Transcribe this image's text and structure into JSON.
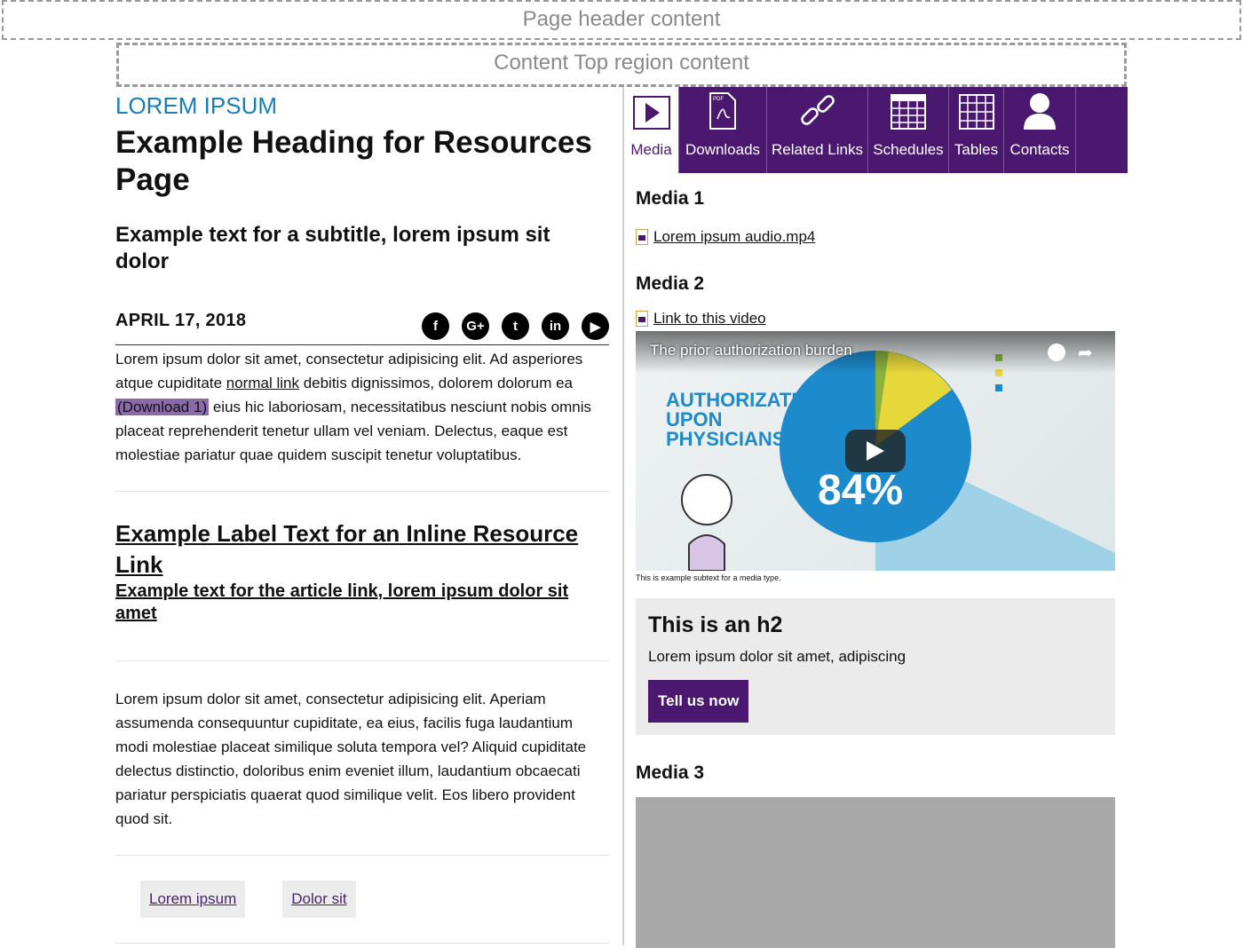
{
  "regions": {
    "header": "Page header content",
    "content_top": "Content Top region content"
  },
  "main": {
    "eyebrow": "LOREM IPSUM",
    "title": "Example Heading for Resources Page",
    "subtitle": "Example text for a subtitle, lorem ipsum sit dolor",
    "date": "APRIL 17, 2018",
    "social": [
      {
        "icon": "facebook-icon",
        "glyph": "f"
      },
      {
        "icon": "google-plus-icon",
        "glyph": "G+"
      },
      {
        "icon": "twitter-icon",
        "glyph": "t"
      },
      {
        "icon": "linkedin-icon",
        "glyph": "in"
      },
      {
        "icon": "youtube-icon",
        "glyph": "▶"
      }
    ],
    "paragraph1": {
      "part1": "Lorem ipsum dolor sit amet, consectetur adipisicing elit. Ad asperiores atque cupiditate ",
      "link": "normal link",
      "part2": " debitis dignissimos, dolorem dolorum ea ",
      "download": "(Download 1)",
      "part3": " eius hic laboriosam, necessitatibus nesciunt nobis omnis placeat reprehenderit tenetur ullam vel veniam. Delectus, eaque est molestiae pariatur quae quidem suscipit tenetur voluptatibus."
    },
    "inline_resource": {
      "label": "Example Label Text for an Inline Resource Link",
      "text": "Example text for the article link, lorem ipsum dolor sit amet"
    },
    "paragraph2": "Lorem ipsum dolor sit amet, consectetur adipisicing elit. Aperiam assumenda consequuntur cupiditate, ea eius, facilis fuga laudantium modi molestiae placeat similique soluta tempora vel? Aliquid cupiditate delectus distinctio, doloribus enim eveniet illum, laudantium obcaecati pariatur perspiciatis quaerat quod similique velit. Eos libero provident quod sit.",
    "tags": [
      "Lorem ipsum",
      "Dolor sit"
    ]
  },
  "tabs": [
    {
      "label": "Media",
      "icon": "play-icon",
      "active": true
    },
    {
      "label": "Downloads",
      "icon": "pdf-icon",
      "active": false
    },
    {
      "label": "Related Links",
      "icon": "link-icon",
      "active": false
    },
    {
      "label": "Schedules",
      "icon": "calendar-grid-icon",
      "active": false
    },
    {
      "label": "Tables",
      "icon": "table-grid-icon",
      "active": false
    },
    {
      "label": "Contacts",
      "icon": "person-icon",
      "active": false
    }
  ],
  "sidebar": {
    "media1": {
      "heading": "Media 1",
      "link": "Lorem ipsum audio.mp4"
    },
    "media2": {
      "heading": "Media 2",
      "link": "Link to this video",
      "video_title": "The prior authorization burden",
      "caption": "This is example subtext for a media type."
    },
    "cta": {
      "heading": "This is an h2",
      "text": "Lorem ipsum dolor sit amet, adipiscing",
      "button": "Tell us now"
    },
    "media3": {
      "heading": "Media 3"
    }
  },
  "colors": {
    "brand_purple": "#4b1870",
    "eyebrow_blue": "#1a7db8",
    "download_highlight": "#8b6aa8"
  }
}
